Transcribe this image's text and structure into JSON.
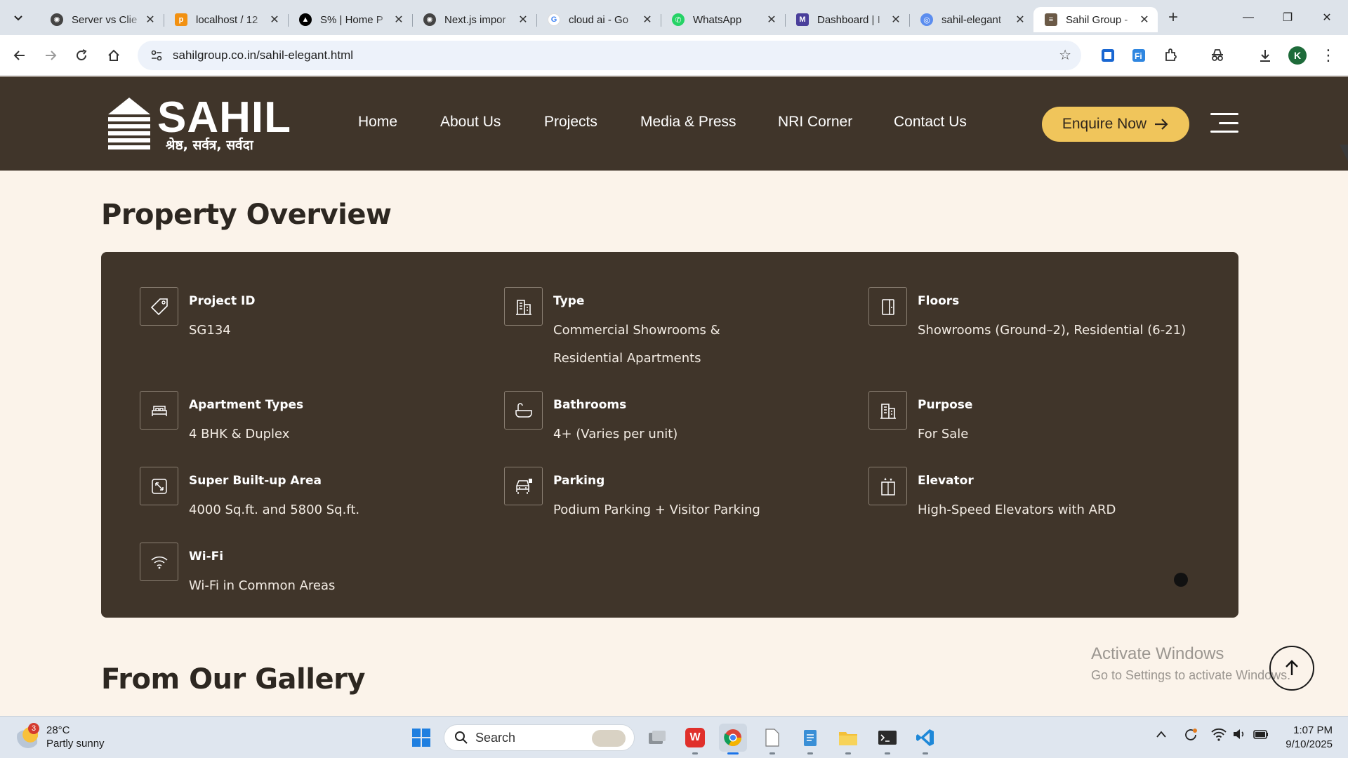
{
  "browser": {
    "tabs": [
      {
        "title": "Server vs Clie",
        "favicon": "chatgpt-icon",
        "active": false
      },
      {
        "title": "localhost / 12",
        "favicon": "phpmyadmin-icon",
        "active": false
      },
      {
        "title": "S% | Home P",
        "favicon": "vercel-icon",
        "active": false
      },
      {
        "title": "Next.js impor",
        "favicon": "chatgpt-icon",
        "active": false
      },
      {
        "title": "cloud ai - Go",
        "favicon": "google-icon",
        "active": false
      },
      {
        "title": "WhatsApp",
        "favicon": "whatsapp-icon",
        "active": false
      },
      {
        "title": "Dashboard | I",
        "favicon": "dashboard-icon",
        "active": false
      },
      {
        "title": "sahil-elegant",
        "favicon": "globe-icon",
        "active": false
      },
      {
        "title": "Sahil Group -",
        "favicon": "sahil-icon",
        "active": true
      }
    ],
    "url": "sahilgroup.co.in/sahil-elegant.html",
    "profile_initial": "K"
  },
  "site": {
    "logo_word": "SAHIL",
    "logo_tagline": "श्रेष्ठ, सर्वत्र, सर्वदा",
    "nav": [
      "Home",
      "About Us",
      "Projects",
      "Media & Press",
      "NRI Corner",
      "Contact Us"
    ],
    "cta_label": "Enquire Now",
    "overview_title": "Property Overview",
    "gallery_title": "From Our Gallery",
    "features": [
      {
        "label": "Project ID",
        "value": "SG134",
        "icon": "tag-icon"
      },
      {
        "label": "Type",
        "value": "Commercial Showrooms & Residential Apartments",
        "icon": "building-icon"
      },
      {
        "label": "Floors",
        "value": "Showrooms (Ground–2), Residential (6-21)",
        "icon": "door-icon"
      },
      {
        "label": "Apartment Types",
        "value": "4 BHK & Duplex",
        "icon": "bed-icon"
      },
      {
        "label": "Bathrooms",
        "value": "4+ (Varies per unit)",
        "icon": "bathtub-icon"
      },
      {
        "label": "Purpose",
        "value": "For Sale",
        "icon": "building-icon"
      },
      {
        "label": "Super Built-up Area",
        "value": "4000 Sq.ft. and 5800 Sq.ft.",
        "icon": "area-icon"
      },
      {
        "label": "Parking",
        "value": "Podium Parking + Visitor Parking",
        "icon": "car-icon"
      },
      {
        "label": "Elevator",
        "value": "High-Speed Elevators with ARD",
        "icon": "elevator-icon"
      },
      {
        "label": "Wi-Fi",
        "value": "Wi-Fi in Common Areas",
        "icon": "wifi-icon"
      }
    ]
  },
  "watermark": {
    "line1": "Activate Windows",
    "line2": "Go to Settings to activate Windows."
  },
  "taskbar": {
    "weather_temp": "28°C",
    "weather_desc": "Partly sunny",
    "weather_badge": "3",
    "search_placeholder": "Search",
    "time": "1:07 PM",
    "date": "9/10/2025"
  },
  "colors": {
    "header_bg": "#40352a",
    "page_bg": "#fbf3ea",
    "cta_bg": "#f0c55b"
  }
}
